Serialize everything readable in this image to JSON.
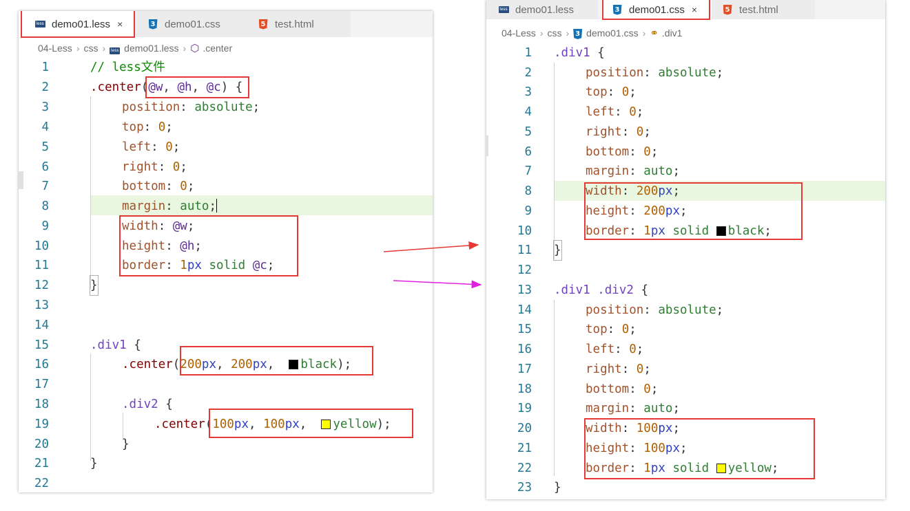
{
  "left": {
    "tabs": [
      {
        "label": "demo01.less",
        "icon": "less-file-icon",
        "active": true
      },
      {
        "label": "demo01.css",
        "icon": "css-file-icon",
        "active": false
      },
      {
        "label": "test.html",
        "icon": "html-file-icon",
        "active": false
      }
    ],
    "close_glyph": "×",
    "breadcrumb": [
      "04-Less",
      "css",
      "demo01.less",
      ".center"
    ],
    "line_numbers": [
      "1",
      "2",
      "3",
      "4",
      "5",
      "6",
      "7",
      "8",
      "9",
      "10",
      "11",
      "12",
      "13",
      "14",
      "15",
      "16",
      "17",
      "18",
      "19",
      "20",
      "21",
      "22"
    ]
  },
  "right": {
    "tabs": [
      {
        "label": "demo01.less",
        "icon": "less-file-icon",
        "active": false
      },
      {
        "label": "demo01.css",
        "icon": "css-file-icon",
        "active": true
      },
      {
        "label": "test.html",
        "icon": "html-file-icon",
        "active": false
      }
    ],
    "close_glyph": "×",
    "breadcrumb": [
      "04-Less",
      "css",
      "demo01.css",
      ".div1"
    ],
    "line_numbers": [
      "1",
      "2",
      "3",
      "4",
      "5",
      "6",
      "7",
      "8",
      "9",
      "10",
      "11",
      "12",
      "13",
      "14",
      "15",
      "16",
      "17",
      "18",
      "19",
      "20",
      "21",
      "22",
      "23"
    ]
  },
  "colors": {
    "red_box": "#e53935",
    "arrow_red": "#e53935",
    "arrow_magenta": "#e020e0",
    "line_highlight": "#e9f7e0"
  },
  "icons": {
    "less": "less",
    "css": "3",
    "html": "5"
  },
  "code": {
    "less": {
      "l1_comment": "// less文件",
      "l2_sel": ".center",
      "l2_paren_open": "(",
      "l2_w": "@w",
      "l2_comma1": ", ",
      "l2_h": "@h",
      "l2_comma2": ", ",
      "l2_c": "@c",
      "l2_paren_close": ")",
      "l2_brace": " {",
      "position_prop": "position",
      "position_val": "absolute",
      "top_prop": "top",
      "left_prop": "left",
      "right_prop": "right",
      "bottom_prop": "bottom",
      "zero": "0",
      "margin_prop": "margin",
      "margin_val": "auto",
      "width_prop": "width",
      "width_val": "@w",
      "height_prop": "height",
      "height_val": "@h",
      "border_prop": "border",
      "border_num": "1",
      "border_unit": "px",
      "border_style": "solid",
      "border_var": "@c",
      "close_brace": "}",
      "div1_sel": ".div1",
      "open_brace": " {",
      "call1_name": ".center",
      "call1_a": "200",
      "call1_b": "200",
      "call1_color": "black",
      "div2_sel": ".div2",
      "call2_name": ".center",
      "call2_a": "100",
      "call2_b": "100",
      "call2_color": "yellow",
      "px": "px",
      "paren_open": "(",
      "paren_close": ");",
      "comma": ", ",
      "colon": ": ",
      "semi": ";"
    },
    "css": {
      "div1_sel": ".div1",
      "open_brace": " {",
      "div1_div2_a": ".div1",
      "div1_div2_b": ".div2",
      "w1": "200",
      "h1": "200",
      "c1": "black",
      "w2": "100",
      "h2": "100",
      "c2": "yellow"
    }
  }
}
